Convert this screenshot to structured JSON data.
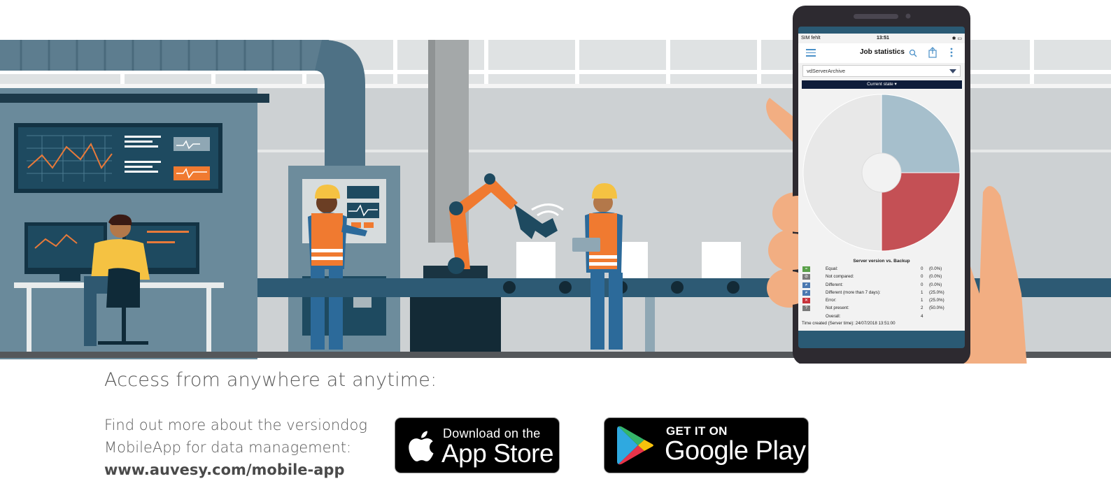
{
  "headline": "Access from anywhere at anytime:",
  "info": {
    "line1": "Find out more about the versiondog",
    "line2": "MobileApp for data management:",
    "url": "www.auvesy.com/mobile-app"
  },
  "app_store": {
    "small": "Download on the",
    "big": "App Store"
  },
  "google_play": {
    "small": "GET IT ON",
    "big": "Google Play"
  },
  "phone": {
    "status": {
      "carrier": "SIM fehlt",
      "time": "13:51"
    },
    "app_title": "Job statistics",
    "select_value": "vdServerArchive",
    "state_button": "Current state ▾",
    "chart_title": "Server version vs. Backup",
    "rows": [
      {
        "label": "Equal:",
        "count": "0",
        "pct": "(0.0%)"
      },
      {
        "label": "Not compared:",
        "count": "0",
        "pct": "(0.0%)"
      },
      {
        "label": "Different:",
        "count": "0",
        "pct": "(0.0%)"
      },
      {
        "label": "Different (more than 7 days):",
        "count": "1",
        "pct": "(25.0%)"
      },
      {
        "label": "Error:",
        "count": "1",
        "pct": "(25.0%)"
      },
      {
        "label": "Not present:",
        "count": "2",
        "pct": "(50.0%)"
      },
      {
        "label": "Overall:",
        "count": "4",
        "pct": ""
      }
    ],
    "time_created": "Time created (Server time): 24/07/2018 13:51:00",
    "icon_colors": {
      "equal": "#5aa04a",
      "not_compared": "#7a7a7a",
      "different": "#4a78b0",
      "different_7": "#4a78b0",
      "error": "#c8323a",
      "not_present": "#7a7a7a"
    }
  },
  "chart_data": {
    "type": "pie",
    "title": "Server version vs. Backup",
    "categories": [
      "Different (more than 7 days)",
      "Error",
      "Not present"
    ],
    "values": [
      25.0,
      25.0,
      50.0
    ],
    "colors": [
      "#a6bfcc",
      "#c45055",
      "#e8e8e8"
    ]
  }
}
